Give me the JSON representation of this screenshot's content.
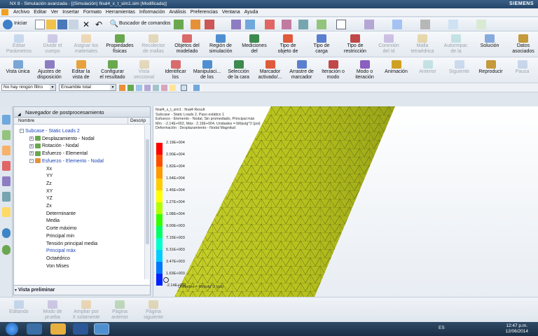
{
  "window": {
    "title": "NX 8 - Simulación avanzada - [(Simulación) final4_x_t_sim1.sim (Modificada)]",
    "brand": "SIEMENS"
  },
  "menu": [
    "Archivo",
    "Editar",
    "Ver",
    "Insertar",
    "Formato",
    "Herramientas",
    "Información",
    "Análisis",
    "Preferencias",
    "Ventana",
    "Ayuda"
  ],
  "quick": {
    "start": "Iniciar",
    "command_finder": "Buscador de comandos"
  },
  "ribbon1": [
    {
      "l1": "Editar",
      "l2": "Parámetros",
      "dis": true
    },
    {
      "l1": "Dividir el",
      "l2": "cuerpo",
      "dis": true
    },
    {
      "l1": "Asignar los",
      "l2": "materiales",
      "dis": true
    },
    {
      "l1": "Propiedades",
      "l2": "físicas",
      "dis": false
    },
    {
      "l1": "Recolector",
      "l2": "de mallas",
      "dis": true
    },
    {
      "l1": "Objetos del",
      "l2": "modelado",
      "dis": false
    },
    {
      "l1": "Región de",
      "l2": "simulación",
      "dis": false
    },
    {
      "l1": "Mediciones",
      "l2": "del",
      "dis": false
    },
    {
      "l1": "Tipo de",
      "l2": "objeto de",
      "dis": false
    },
    {
      "l1": "Tipo de",
      "l2": "carga",
      "dis": false
    },
    {
      "l1": "Tipo de",
      "l2": "restricción",
      "dis": false
    },
    {
      "l1": "Conexión",
      "l2": "del Id",
      "dis": true
    },
    {
      "l1": "Malla",
      "l2": "tetraédrica",
      "dis": true
    },
    {
      "l1": "Autorrepar.",
      "l2": "de la",
      "dis": true
    },
    {
      "l1": "Solución",
      "l2": "",
      "dis": false
    },
    {
      "l1": "Datos",
      "l2": "asociados",
      "dis": false
    }
  ],
  "ribbon2": [
    {
      "l1": "Vista única",
      "l2": "",
      "dis": false
    },
    {
      "l1": "Ajustes de",
      "l2": "disposición",
      "dis": false
    },
    {
      "l1": "Editar la",
      "l2": "vista de",
      "dis": false
    },
    {
      "l1": "Configurar",
      "l2": "el resultado",
      "dis": false
    },
    {
      "l1": "Vista",
      "l2": "seccional",
      "dis": true
    },
    {
      "l1": "Identificar",
      "l2": "los",
      "dis": false
    },
    {
      "l1": "Manipulaci...",
      "l2": "de los",
      "dis": false
    },
    {
      "l1": "Selección",
      "l2": "de la cara",
      "dis": false
    },
    {
      "l1": "Marcador",
      "l2": "activado/...",
      "dis": false
    },
    {
      "l1": "Arrastre de",
      "l2": "marcador",
      "dis": false
    },
    {
      "l1": "Iteración o",
      "l2": "modo",
      "dis": false
    },
    {
      "l1": "Modo o",
      "l2": "iteración",
      "dis": false
    },
    {
      "l1": "Animación",
      "l2": "",
      "dis": false
    },
    {
      "l1": "Anterior",
      "l2": "",
      "dis": true
    },
    {
      "l1": "Siguiente",
      "l2": "",
      "dis": true
    },
    {
      "l1": "Reproducir",
      "l2": "",
      "dis": false
    },
    {
      "l1": "Pausa",
      "l2": "",
      "dis": true
    }
  ],
  "filter": {
    "selection_filter": "No hay ningún filtro",
    "assembly_scope": "Ensamble total"
  },
  "navigator": {
    "title": "Navegador de postprocesamiento",
    "col_name": "Nombre",
    "col_desc": "Descrip",
    "subcase": "Subcase - Static Loads 2",
    "branches": [
      "Desplazamiento - Nodal",
      "Rotación - Nodal",
      "Esfuerzo - Elemental",
      "Esfuerzo - Elemento - Nodal"
    ],
    "leaves": [
      "Xx",
      "YY",
      "Zz",
      "XY",
      "YZ",
      "Zx",
      "Determinante",
      "Media",
      "Corte máximo",
      "Principal min",
      "Tensión principal media",
      "Principal máx",
      "Octaédrico",
      "Von Mises"
    ],
    "preview": "Vista preliminar"
  },
  "viewport": {
    "header": [
      "final4_x_t_sim1 : final4 Result",
      "Subcase - Static Loads 2, Paso estático 1",
      "Esfuerzo - Elemento - Nodal, Sin promediado, Principal máx",
      "Mín : -2.14E+002, Máx : 2.19E+004, Unidades = lbf/pulg^2 (psi)",
      "Deformación : Desplazamiento - Nodal Magnitud"
    ],
    "legend_values": [
      "2.19E+004",
      "2.00E+004",
      "1.82E+004",
      "1.64E+004",
      "1.45E+004",
      "1.27E+004",
      "1.08E+004",
      "9.00E+003",
      "7.15E+003",
      "5.31E+003",
      "3.47E+003",
      "1.63E+003",
      "-2.14E+002"
    ],
    "units": "Unidades = lbf/pulg^2 (psi)",
    "legend_colors": [
      "#ff0000",
      "#ff4d00",
      "#ff9900",
      "#ffcc00",
      "#ffff00",
      "#b3ff00",
      "#33ff00",
      "#00ff66",
      "#00ffcc",
      "#00ccff",
      "#0077ff",
      "#0022ff",
      "#2200cc"
    ]
  },
  "bottom": [
    {
      "l1": "Editando",
      "l2": "",
      "dis": true
    },
    {
      "l1": "Modo de",
      "l2": "prueba",
      "dis": true
    },
    {
      "l1": "Ampliar por",
      "l2": "X solamente",
      "dis": true
    },
    {
      "l1": "Página",
      "l2": "anterior",
      "dis": true
    },
    {
      "l1": "Página",
      "l2": "siguiente",
      "dis": true
    }
  ],
  "taskbar": {
    "lang": "ES",
    "time": "12:47 p.m.",
    "date": "12/06/2014"
  }
}
